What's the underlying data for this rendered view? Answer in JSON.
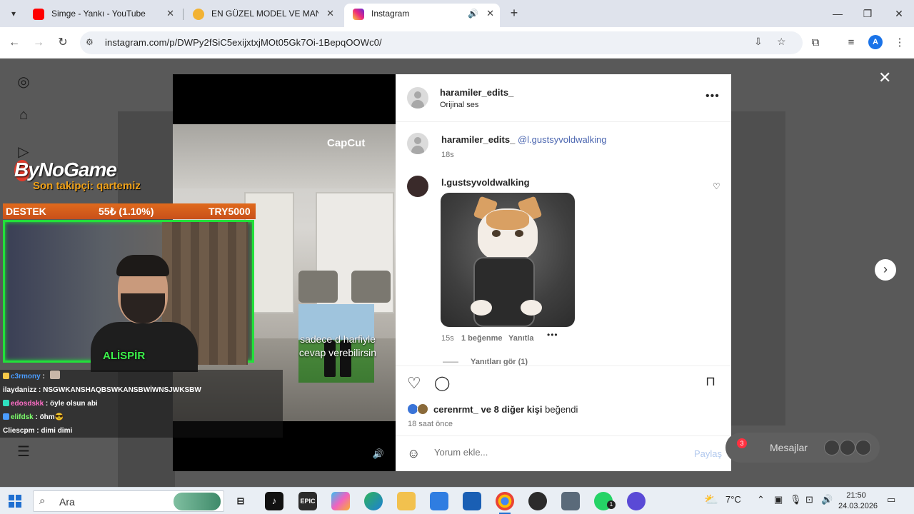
{
  "browser": {
    "tabs": [
      {
        "title": "Simge - Yankı - YouTube",
        "icon": "youtube-icon",
        "color": "#ff0000"
      },
      {
        "title": "EN GÜZEL MODEL VE MANKEN",
        "icon": "globe-icon",
        "color": "#f2b233"
      },
      {
        "title": "Instagram",
        "icon": "instagram-icon",
        "color": "#d62976"
      }
    ],
    "url": "instagram.com/p/DWPy2fSiC5exijxtxjMOt05Gk7Oi-1BepqOOWc0/",
    "profile_letter": "A"
  },
  "stream_overlay": {
    "brand": "ByNoGame",
    "last_follower": "Son takipçi: qartemiz",
    "support_bar": {
      "label": "DESTEK",
      "progress": "55₺ (1.10%)",
      "goal": "TRY5000"
    },
    "cam_name": "ALİSPİR",
    "chat": [
      {
        "user": "c3rmony",
        "message": "",
        "user_color": "#4a9cff",
        "badge": "#f7c948"
      },
      {
        "user": "ilaydanizz",
        "message": "NSGWKANSHAQBSWKANSBWİWNSJWKSBW",
        "user_color": "#ffffff",
        "badge": ""
      },
      {
        "user": "edosdskk",
        "message": "öyle olsun abi",
        "user_color": "#ff6ec7",
        "badge": "#2ee0c0"
      },
      {
        "user": "elifdsk",
        "message": "öhm😎",
        "user_color": "#7cff6b",
        "badge": "#4a9cff"
      },
      {
        "user": "Cliescpm",
        "message": "dimi dimi",
        "user_color": "#ffffff",
        "badge": ""
      }
    ]
  },
  "video": {
    "watermark": "CapCut",
    "caption": "sadece d harfiyle cevap verebilirsin"
  },
  "post": {
    "author": "haramiler_edits_",
    "audio": "Orijinal ses",
    "caption_user": "haramiler_edits_",
    "caption_mention": "@l.gustsyvoldwalking",
    "caption_time": "18s",
    "comment": {
      "user": "l.gustsyvoldwalking",
      "time": "15s",
      "likes": "1 beğenme",
      "reply": "Yanıtla",
      "view_replies": "Yanıtları gör (1)"
    },
    "liked_by_user": "cerenrmt_",
    "liked_by_rest": "ve 8 diğer kişi",
    "liked_by_suffix": "beğendi",
    "posted": "18 saat önce",
    "comment_placeholder": "Yorum ekle...",
    "post_button": "Paylaş"
  },
  "messages": {
    "label": "Mesajlar",
    "count": "3"
  },
  "taskbar": {
    "search_placeholder": "Ara",
    "weather": "7°C",
    "time": "21:50",
    "date": "24.03.2026",
    "whatsapp_badge": "1"
  }
}
